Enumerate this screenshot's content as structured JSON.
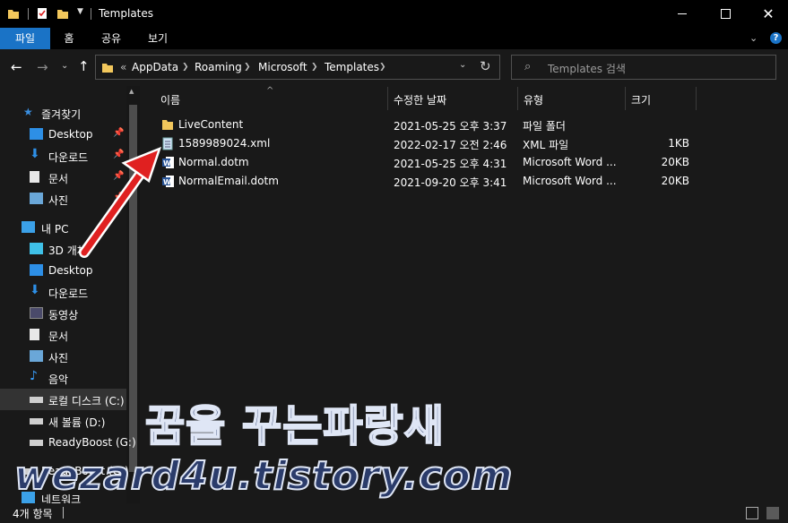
{
  "window": {
    "title": "Templates"
  },
  "ribbon": {
    "tabs": [
      "파일",
      "홈",
      "공유",
      "보기"
    ]
  },
  "address": {
    "overflow": "«",
    "crumbs": [
      "AppData",
      "Roaming",
      "Microsoft",
      "Templates"
    ]
  },
  "search": {
    "placeholder": "Templates 검색"
  },
  "sidebar": {
    "quick_access": "즐겨찾기",
    "pinned": [
      "Desktop",
      "다운로드",
      "문서",
      "사진"
    ],
    "this_pc": "내 PC",
    "pc_items": [
      "3D 개체",
      "Desktop",
      "다운로드",
      "동영상",
      "문서",
      "사진",
      "음악",
      "로컬 디스크 (C:)",
      "새 볼륨 (D:)",
      "ReadyBoost (G:)"
    ],
    "extra": [
      "ReadyBoost (G:)",
      "네트워크"
    ]
  },
  "columns": {
    "name": "이름",
    "date": "수정한 날짜",
    "type": "유형",
    "size": "크기"
  },
  "files": [
    {
      "name": "LiveContent",
      "date": "2021-05-25 오후 3:37",
      "type": "파일 폴더",
      "size": "",
      "icon": "folder-icon"
    },
    {
      "name": "1589989024.xml",
      "date": "2022-02-17 오전 2:46",
      "type": "XML 파일",
      "size": "1KB",
      "icon": "xml-file-icon"
    },
    {
      "name": "Normal.dotm",
      "date": "2021-05-25 오후 4:31",
      "type": "Microsoft Word ...",
      "size": "20KB",
      "icon": "word-file-icon"
    },
    {
      "name": "NormalEmail.dotm",
      "date": "2021-09-20 오후 3:41",
      "type": "Microsoft Word ...",
      "size": "20KB",
      "icon": "word-file-icon"
    }
  ],
  "status": {
    "count": "4개 항목"
  },
  "watermark": {
    "line1": "꿈을 꾸는파랑새",
    "line2": "wezard4u.tistory.com"
  },
  "colors": {
    "accent": "#1a73c6",
    "folder": "#f2c75c",
    "arrow": "#e02020"
  }
}
